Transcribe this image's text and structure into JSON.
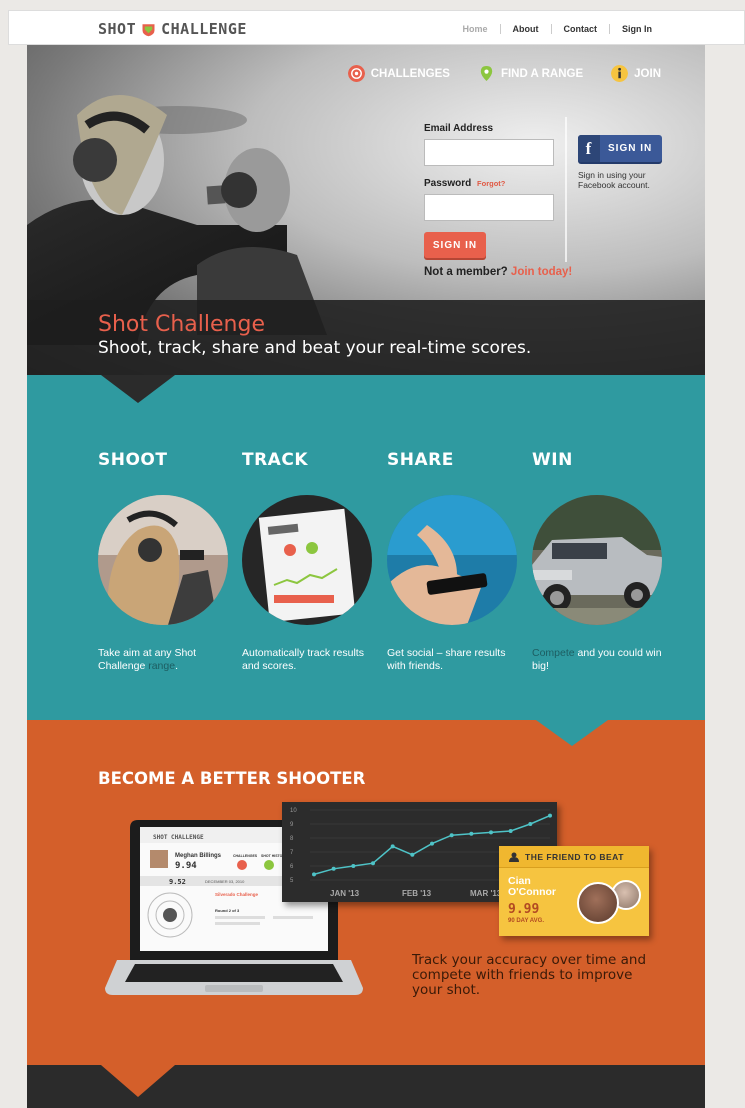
{
  "brand": {
    "name": "SHOT CHALLENGE"
  },
  "topnav": [
    "Home",
    "About",
    "Contact",
    "Sign In"
  ],
  "heronav": [
    {
      "label": "CHALLENGES",
      "icon": "target-icon",
      "color": "#e8604c"
    },
    {
      "label": "FIND A RANGE",
      "icon": "map-pin-icon",
      "color": "#8cc63f"
    },
    {
      "label": "JOIN",
      "icon": "info-icon",
      "color": "#f6c440"
    }
  ],
  "login": {
    "email_label": "Email Address",
    "email_value": "",
    "password_label": "Password",
    "forgot": "Forgot?",
    "password_value": "",
    "signin": "SIGN IN",
    "not_member": "Not a member?",
    "join_today": "Join today!"
  },
  "facebook": {
    "button": "SIGN IN",
    "text": "Sign in using your Facebook account."
  },
  "hero": {
    "title": "Shot Challenge",
    "subtitle": "Shoot, track, share and beat your real-time scores."
  },
  "features": [
    {
      "title": "SHOOT",
      "text_before": "Take aim at any Shot Challenge ",
      "highlight": "range",
      "text_after": "."
    },
    {
      "title": "TRACK",
      "text_before": "Automatically track results and scores.",
      "highlight": "",
      "text_after": ""
    },
    {
      "title": "SHARE",
      "text_before": "Get social – share results with friends.",
      "highlight": "",
      "text_after": ""
    },
    {
      "title": "WIN",
      "text_before": "",
      "highlight": "Compete",
      "text_after": " and you could win big!"
    }
  ],
  "better": {
    "title": "BECOME A BETTER SHOOTER",
    "track_text": "Track your accuracy over time and compete with friends to improve your shot."
  },
  "laptop": {
    "brand": "SHOT CHALLENGE",
    "user": "Meghan Billings",
    "score": "9.94",
    "score2": "9.52",
    "date": "DECEMBER 03, 2010",
    "challenge": "Silverado Challenge",
    "round": "Round 2 of 3",
    "tabs": [
      "CHALLENGES",
      "SHOT HISTORY"
    ]
  },
  "chart_data": {
    "type": "line",
    "x": [
      "JAN '13",
      "FEB '13",
      "MAR '13"
    ],
    "yticks": [
      5,
      6,
      7,
      8,
      9,
      10
    ],
    "ylim": [
      5,
      10
    ],
    "values": [
      5.4,
      5.8,
      6.0,
      6.2,
      7.4,
      6.8,
      7.6,
      8.2,
      8.3,
      8.4,
      8.5,
      9.0,
      9.6
    ],
    "line_color": "#4ec3c7"
  },
  "friend": {
    "title": "THE FRIEND TO BEAT",
    "name": "Cian O'Connor",
    "score": "9.99",
    "avg": "90 DAY AVG."
  }
}
